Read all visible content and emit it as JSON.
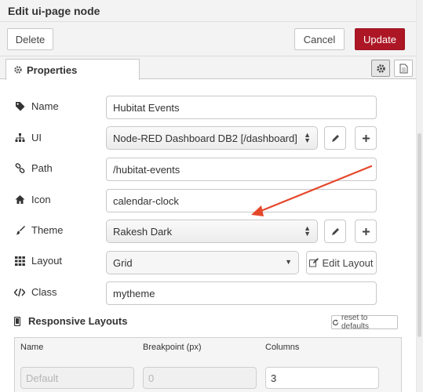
{
  "header": {
    "title": "Edit ui-page node"
  },
  "actions": {
    "delete_label": "Delete",
    "cancel_label": "Cancel",
    "update_label": "Update"
  },
  "tabs": {
    "properties_label": "Properties"
  },
  "form": {
    "name": {
      "label": "Name",
      "value": "Hubitat Events"
    },
    "ui": {
      "label": "UI",
      "value": "Node-RED Dashboard DB2 [/dashboard]"
    },
    "path": {
      "label": "Path",
      "value": "/hubitat-events"
    },
    "icon": {
      "label": "Icon",
      "value": "calendar-clock"
    },
    "theme": {
      "label": "Theme",
      "value": "Rakesh Dark"
    },
    "layout": {
      "label": "Layout",
      "value": "Grid",
      "edit_label": "Edit Layout"
    },
    "class": {
      "label": "Class",
      "value": "mytheme"
    }
  },
  "responsive": {
    "title": "Responsive Layouts",
    "reset_label": "reset to defaults",
    "columns": [
      "Name",
      "Breakpoint (px)",
      "Columns"
    ],
    "row": {
      "name_placeholder": "Default",
      "breakpoint_value": "0",
      "columns_value": "3"
    }
  },
  "annotation": {
    "arrow_color": "#e5472b"
  },
  "colors": {
    "primary": "#ad1625"
  },
  "icons": {
    "name": "tag-icon",
    "ui": "sitemap-icon",
    "path": "link-icon",
    "icon": "home-icon",
    "theme": "paintbrush-icon",
    "layout": "grid-icon",
    "class": "code-icon",
    "responsive": "mobile-icon"
  }
}
